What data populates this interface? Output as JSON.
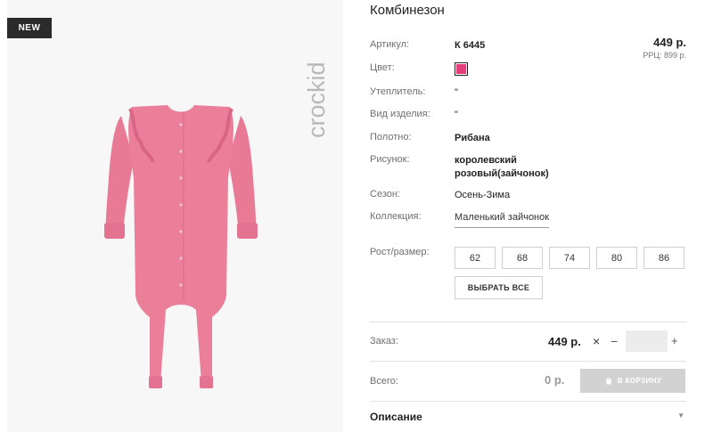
{
  "badge": "NEW",
  "brand": "crockid",
  "product": {
    "title": "Комбинезон",
    "price": "449 р.",
    "rrp": "РРЦ: 899 р.",
    "color_hex": "#e63e78"
  },
  "details": {
    "article_label": "Артикул:",
    "article_value": "К 6445",
    "color_label": "Цвет:",
    "insulation_label": "Утеплитель:",
    "insulation_value": "\"",
    "type_label": "Вид изделия:",
    "type_value": "\"",
    "fabric_label": "Полотно:",
    "fabric_value": "Рибана",
    "pattern_label": "Рисунок:",
    "pattern_line1": "королевский",
    "pattern_line2": "розовый(зайчонок)",
    "season_label": "Сезон:",
    "season_value": "Осень-Зима",
    "collection_label": "Коллекция:",
    "collection_value": "Маленький зайчонок"
  },
  "sizes": {
    "label": "Рост/размер:",
    "options": [
      "62",
      "68",
      "74",
      "80",
      "86"
    ],
    "select_all": "ВЫБРАТЬ ВСЕ"
  },
  "order": {
    "label": "Заказ:",
    "price": "449 р.",
    "times": "×",
    "minus": "−",
    "plus": "+",
    "quantity": ""
  },
  "total": {
    "label": "Всего:",
    "value": "0 р.",
    "cart_button": "В КОРЗИНУ"
  },
  "description": {
    "label": "Описание",
    "chevron": "▼"
  }
}
